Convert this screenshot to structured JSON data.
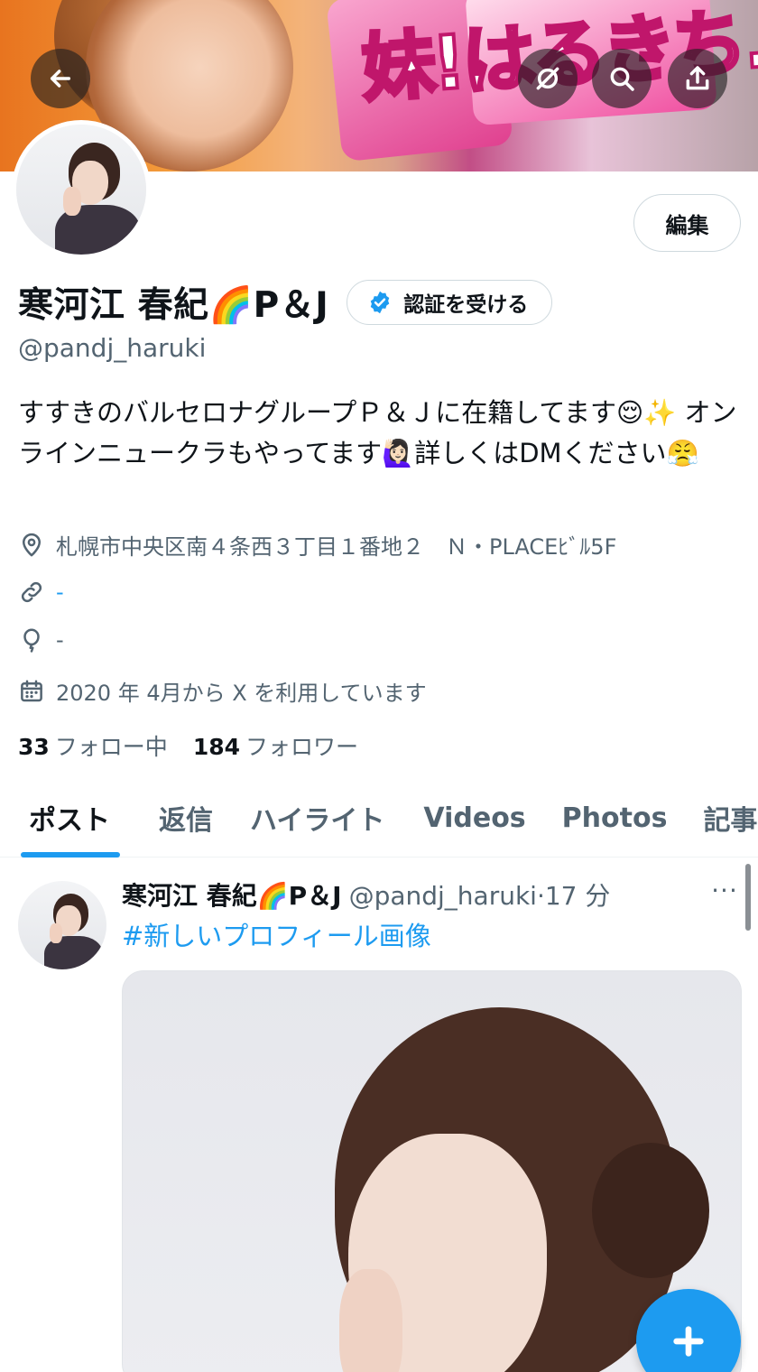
{
  "banner": {
    "text": "妹!はるきち."
  },
  "profile": {
    "name": "寒河江 春紀🌈P＆J",
    "handle": "@pandj_haruki",
    "edit_label": "編集",
    "verify_label": "認証を受ける",
    "bio": "すすきのバルセロナグループＰ＆Ｊに在籍してます😌✨ オンラインニュークラもやってます🙋🏻‍♀️詳しくはDMください😤",
    "location": "札幌市中央区南４条西３丁目１番地２　Ｎ・PLACEﾋﾞﾙ5F",
    "link": "-",
    "birthday": "-",
    "joined": "2020 年 4月から X を利用しています",
    "following_count": "33",
    "following_label": "フォロー中",
    "followers_count": "184",
    "followers_label": "フォロワー"
  },
  "tabs": [
    {
      "label": "ポスト",
      "active": true
    },
    {
      "label": "返信",
      "active": false
    },
    {
      "label": "ハイライト",
      "active": false
    },
    {
      "label": "Videos",
      "active": false
    },
    {
      "label": "Photos",
      "active": false
    },
    {
      "label": "記事",
      "active": false
    }
  ],
  "post": {
    "name": "寒河江 春紀🌈P＆J",
    "handle_time": "@pandj_haruki·17 分",
    "more": "···",
    "hashtag": "#新しいプロフィール画像"
  },
  "colors": {
    "accent": "#1d9bf0",
    "secondary_text": "#536471",
    "primary_text": "#0f1419"
  },
  "icons": {
    "back": "arrow-left-icon",
    "mute": "eye-slash-icon",
    "search": "search-icon",
    "share": "share-icon",
    "verified": "verified-badge-icon",
    "location": "location-pin-icon",
    "link": "link-icon",
    "birthday": "balloon-icon",
    "calendar": "calendar-icon",
    "compose": "plus-icon"
  }
}
